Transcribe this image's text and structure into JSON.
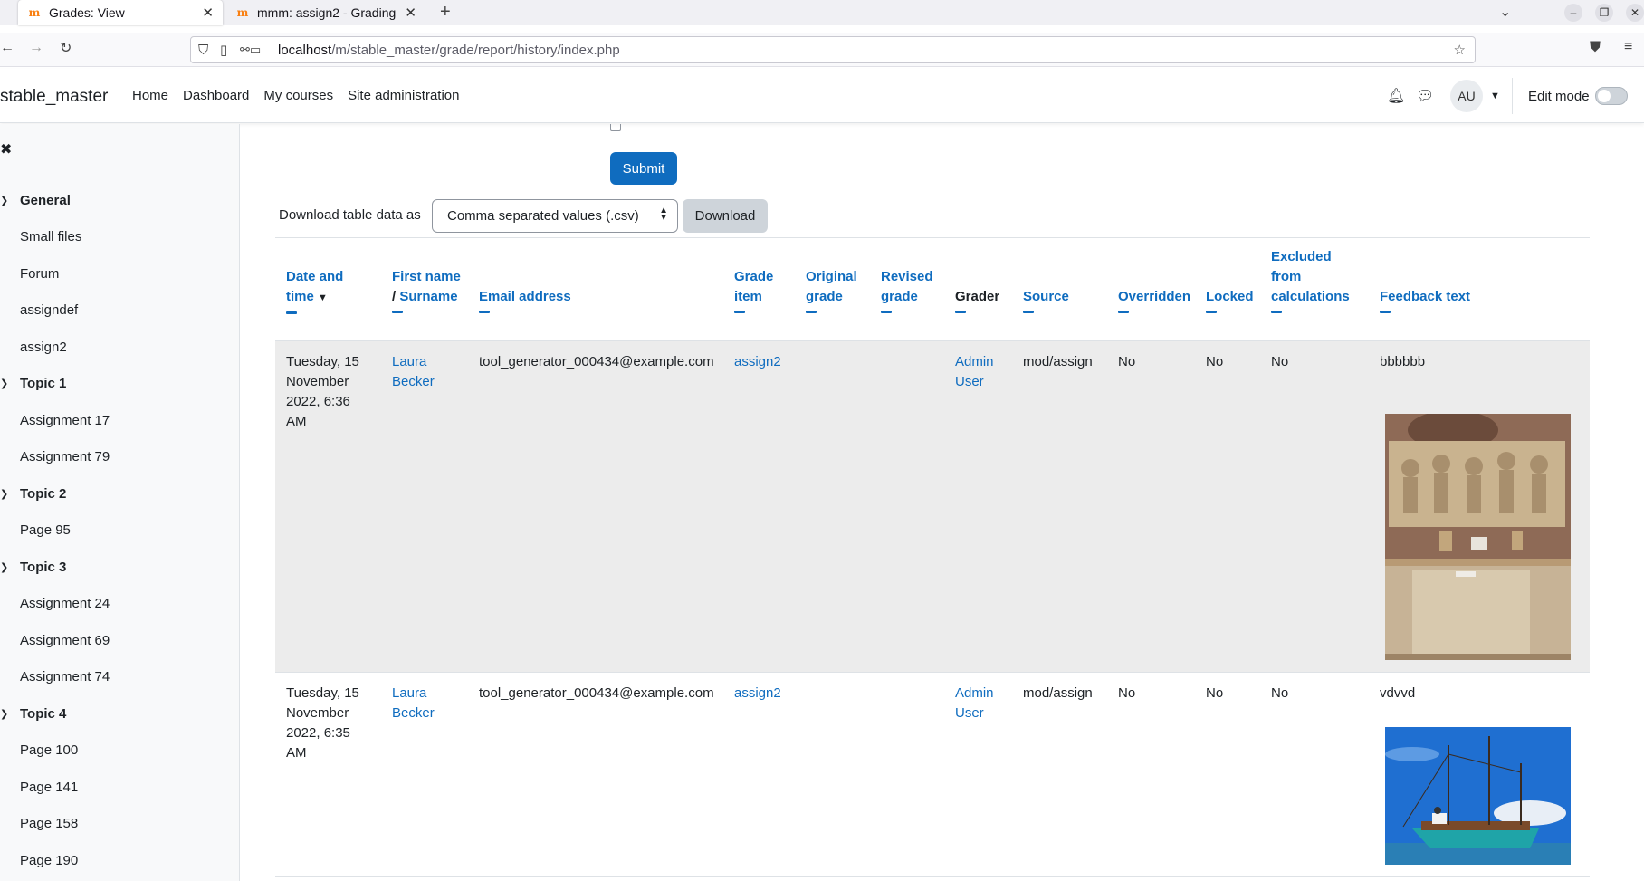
{
  "browser": {
    "tabs": [
      {
        "title": "Grades: View",
        "active": true
      },
      {
        "title": "mmm: assign2 - Grading",
        "active": false
      }
    ],
    "url_host": "localhost",
    "url_path": "/m/stable_master/grade/report/history/index.php"
  },
  "header": {
    "brand": "stable_master",
    "nav": [
      "Home",
      "Dashboard",
      "My courses",
      "Site administration"
    ],
    "avatar_initials": "AU",
    "edit_mode_label": "Edit mode"
  },
  "drawer": {
    "sections": [
      {
        "title": "General",
        "items": [
          "Small files",
          "Forum",
          "assigndef",
          "assign2"
        ]
      },
      {
        "title": "Topic 1",
        "items": [
          "Assignment 17",
          "Assignment 79"
        ]
      },
      {
        "title": "Topic 2",
        "items": [
          "Page 95"
        ]
      },
      {
        "title": "Topic 3",
        "items": [
          "Assignment 24",
          "Assignment 69",
          "Assignment 74"
        ]
      },
      {
        "title": "Topic 4",
        "items": [
          "Page 100",
          "Page 141",
          "Page 158",
          "Page 190"
        ]
      }
    ]
  },
  "form": {
    "submit_label": "Submit",
    "download_label": "Download table data as",
    "download_format": "Comma separated values (.csv)",
    "download_button": "Download"
  },
  "table": {
    "headers": {
      "date": "Date and time",
      "first_name": "First name",
      "surname": "Surname",
      "email": "Email address",
      "grade_item": "Grade item",
      "original_grade": "Original grade",
      "revised_grade": "Revised grade",
      "grader": "Grader",
      "source": "Source",
      "overridden": "Overridden",
      "locked": "Locked",
      "excluded": "Excluded from calculations",
      "feedback": "Feedback text"
    },
    "rows": [
      {
        "date": "Tuesday, 15 November 2022, 6:36 AM",
        "name": "Laura Becker",
        "email": "tool_generator_000434@example.com",
        "grade_item": "assign2",
        "original_grade": "",
        "revised_grade": "",
        "grader": "Admin User",
        "source": "mod/assign",
        "overridden": "No",
        "locked": "No",
        "excluded": "No",
        "feedback": "bbbbbb"
      },
      {
        "date": "Tuesday, 15 November 2022, 6:35 AM",
        "name": "Laura Becker",
        "email": "tool_generator_000434@example.com",
        "grade_item": "assign2",
        "original_grade": "",
        "revised_grade": "",
        "grader": "Admin User",
        "source": "mod/assign",
        "overridden": "No",
        "locked": "No",
        "excluded": "No",
        "feedback": "vdvvd"
      }
    ]
  }
}
